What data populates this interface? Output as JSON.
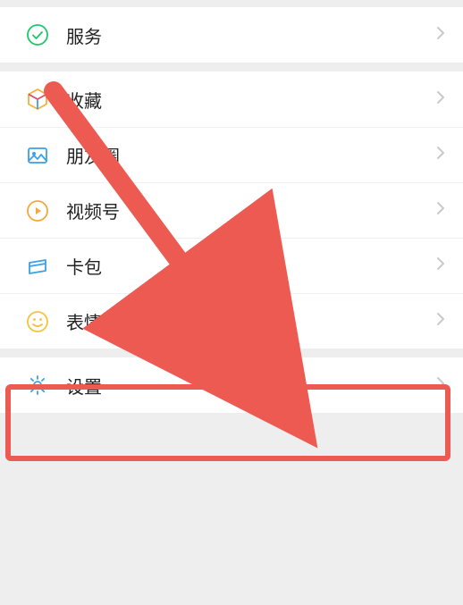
{
  "groups": [
    {
      "items": [
        {
          "id": "service",
          "label": "服务",
          "icon": "service-icon"
        }
      ]
    },
    {
      "items": [
        {
          "id": "favorites",
          "label": "收藏",
          "icon": "cube-icon"
        },
        {
          "id": "moments",
          "label": "朋友圈",
          "icon": "picture-icon"
        },
        {
          "id": "channels",
          "label": "视频号",
          "icon": "play-icon"
        },
        {
          "id": "cards",
          "label": "卡包",
          "icon": "card-icon"
        },
        {
          "id": "stickers",
          "label": "表情",
          "icon": "smile-icon"
        }
      ]
    },
    {
      "items": [
        {
          "id": "settings",
          "label": "设置",
          "icon": "gear-icon"
        }
      ]
    }
  ],
  "annotation": {
    "highlight_target": "settings",
    "arrow_color": "#ec5a52"
  }
}
